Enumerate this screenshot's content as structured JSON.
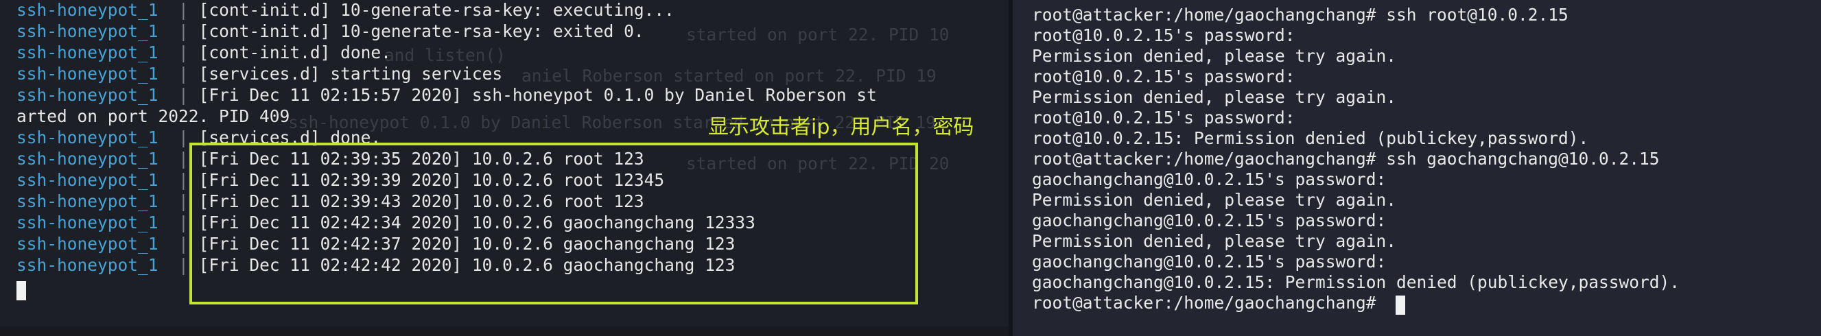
{
  "left_terminal": {
    "prefix": "ssh-honeypot_1",
    "separator": "|",
    "lines": [
      "[cont-init.d] 10-generate-rsa-key: executing...",
      "[cont-init.d] 10-generate-rsa-key: exited 0.",
      "[cont-init.d] done.",
      "[services.d] starting services",
      "[Fri Dec 11 02:15:57 2020] ssh-honeypot 0.1.0 by Daniel Roberson st",
      "arted on port 2022. PID 409",
      "[services.d] done.",
      "[Fri Dec 11 02:39:35 2020] 10.0.2.6 root 123",
      "[Fri Dec 11 02:39:39 2020] 10.0.2.6 root 12345",
      "[Fri Dec 11 02:39:43 2020] 10.0.2.6 root 123",
      "[Fri Dec 11 02:42:34 2020] 10.0.2.6 gaochangchang 12333",
      "[Fri Dec 11 02:42:37 2020] 10.0.2.6 gaochangchang 123",
      "[Fri Dec 11 02:42:42 2020] 10.0.2.6 gaochangchang 123"
    ],
    "ghost_lines": [
      "started on port 22. PID 10",
      "and listen()",
      "aniel Roberson started on port 22. PID 19",
      "ssh-honeypot 0.1.0 by Daniel Roberson started on port 22. PID 19",
      "started on port 22. PID 20"
    ]
  },
  "annotation": {
    "text": "显示攻击者ip，用户名，密码",
    "color": "#d8ea32"
  },
  "right_terminal": {
    "lines": [
      "root@attacker:/home/gaochangchang# ssh root@10.0.2.15",
      "root@10.0.2.15's password:",
      "Permission denied, please try again.",
      "root@10.0.2.15's password:",
      "Permission denied, please try again.",
      "root@10.0.2.15's password:",
      "root@10.0.2.15: Permission denied (publickey,password).",
      "root@attacker:/home/gaochangchang# ssh gaochangchang@10.0.2.15",
      "gaochangchang@10.0.2.15's password:",
      "Permission denied, please try again.",
      "gaochangchang@10.0.2.15's password:",
      "Permission denied, please try again.",
      "gaochangchang@10.0.2.15's password:",
      "gaochangchang@10.0.2.15: Permission denied (publickey,password).",
      "root@attacker:/home/gaochangchang# "
    ]
  },
  "colors": {
    "prefix": "#47a3d6",
    "highlight_box": "#c3e23a",
    "background": "#1f2129"
  }
}
